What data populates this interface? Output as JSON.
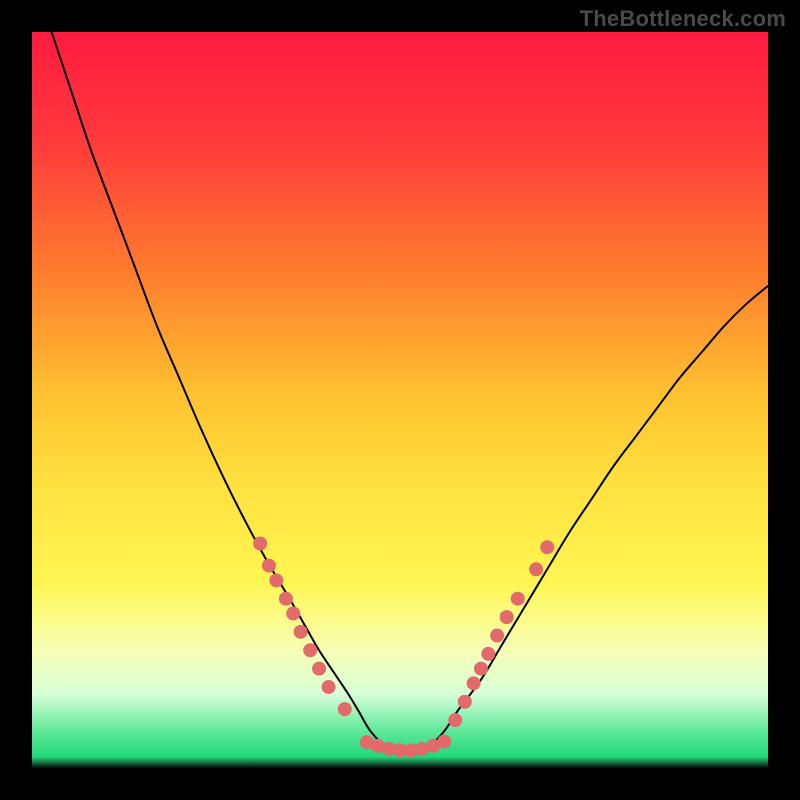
{
  "watermark": "TheBottleneck.com",
  "chart_data": {
    "type": "line",
    "title": "",
    "xlabel": "",
    "ylabel": "",
    "xlim": [
      0,
      100
    ],
    "ylim": [
      0,
      100
    ],
    "background_gradient": {
      "stops": [
        {
          "offset": 0.0,
          "color": "#ff1b3f"
        },
        {
          "offset": 0.15,
          "color": "#ff3a3c"
        },
        {
          "offset": 0.32,
          "color": "#ff7a2e"
        },
        {
          "offset": 0.5,
          "color": "#ffc430"
        },
        {
          "offset": 0.62,
          "color": "#ffe23f"
        },
        {
          "offset": 0.75,
          "color": "#fff653"
        },
        {
          "offset": 0.84,
          "color": "#f7ffb6"
        },
        {
          "offset": 0.9,
          "color": "#d6ffd6"
        },
        {
          "offset": 0.95,
          "color": "#5fe89a"
        },
        {
          "offset": 0.985,
          "color": "#21d87a"
        },
        {
          "offset": 1.0,
          "color": "#0a0a0a"
        }
      ]
    },
    "series": [
      {
        "name": "bottleneck-curve",
        "x": [
          0,
          2,
          5,
          8,
          11,
          14,
          17,
          20,
          23,
          26,
          29,
          32,
          35,
          37,
          39,
          41,
          43,
          44.5,
          46,
          48,
          50,
          52,
          54,
          56,
          58,
          61,
          64,
          67,
          70,
          73,
          76,
          79,
          82,
          85,
          88,
          91,
          94,
          97,
          100
        ],
        "y": [
          108,
          102,
          93,
          84,
          76,
          68,
          60,
          53,
          46,
          39.5,
          33.5,
          28,
          23,
          19.5,
          16,
          13,
          10,
          7.5,
          5,
          3,
          2.2,
          2.2,
          3,
          5,
          8,
          12,
          17,
          22,
          27,
          32,
          36.5,
          41,
          45,
          49,
          53,
          56.5,
          60,
          63,
          65.5
        ]
      }
    ],
    "dot_clusters": [
      {
        "name": "left-cluster",
        "points": [
          {
            "x": 31.0,
            "y": 30.5
          },
          {
            "x": 32.2,
            "y": 27.5
          },
          {
            "x": 33.2,
            "y": 25.5
          },
          {
            "x": 34.5,
            "y": 23.0
          },
          {
            "x": 35.5,
            "y": 21.0
          },
          {
            "x": 36.5,
            "y": 18.5
          },
          {
            "x": 37.8,
            "y": 16.0
          },
          {
            "x": 39.0,
            "y": 13.5
          },
          {
            "x": 40.3,
            "y": 11.0
          },
          {
            "x": 42.5,
            "y": 8.0
          }
        ]
      },
      {
        "name": "bottom-cluster",
        "points": [
          {
            "x": 45.5,
            "y": 3.5
          },
          {
            "x": 47.0,
            "y": 3.0
          },
          {
            "x": 48.5,
            "y": 2.6
          },
          {
            "x": 50.0,
            "y": 2.4
          },
          {
            "x": 51.5,
            "y": 2.4
          },
          {
            "x": 53.0,
            "y": 2.6
          },
          {
            "x": 54.5,
            "y": 3.0
          },
          {
            "x": 56.0,
            "y": 3.6
          }
        ]
      },
      {
        "name": "right-cluster",
        "points": [
          {
            "x": 57.5,
            "y": 6.5
          },
          {
            "x": 58.8,
            "y": 9.0
          },
          {
            "x": 60.0,
            "y": 11.5
          },
          {
            "x": 61.0,
            "y": 13.5
          },
          {
            "x": 62.0,
            "y": 15.5
          },
          {
            "x": 63.2,
            "y": 18.0
          },
          {
            "x": 64.5,
            "y": 20.5
          },
          {
            "x": 66.0,
            "y": 23.0
          },
          {
            "x": 68.5,
            "y": 27.0
          },
          {
            "x": 70.0,
            "y": 30.0
          }
        ]
      }
    ],
    "dot_style": {
      "radius": 7,
      "fill": "#e36a6a",
      "stroke_width": 0
    },
    "curve_style": {
      "stroke": "#000000",
      "stroke_width": 2
    }
  }
}
